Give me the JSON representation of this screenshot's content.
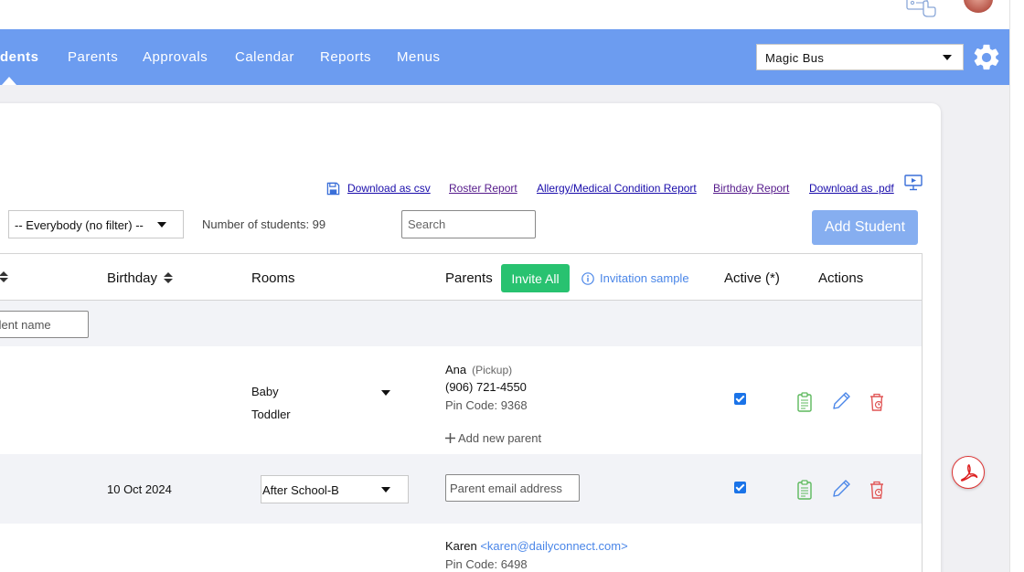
{
  "nav": {
    "items": [
      "dents",
      "Parents",
      "Approvals",
      "Calendar",
      "Reports",
      "Menus"
    ],
    "active_index": 0,
    "org_select": "Magic Bus"
  },
  "toolbar": {
    "download_csv": "Download as csv",
    "roster_report": "Roster Report",
    "allergy_report": "Allergy/Medical Condition Report",
    "birthday_report": "Birthday Report",
    "download_pdf": "Download as .pdf"
  },
  "controls": {
    "filter_value": "-- Everybody (no filter) --",
    "student_count": "Number of students: 99",
    "search_placeholder": "Search",
    "add_student": "Add Student"
  },
  "table": {
    "headers": {
      "birthday": "Birthday",
      "rooms": "Rooms",
      "parents": "Parents",
      "invite_all": "Invite All",
      "invitation_sample": "Invitation sample",
      "active": "Active (*)",
      "actions": "Actions"
    },
    "name_filter_placeholder": "udent name",
    "rows": [
      {
        "birthday": "",
        "rooms": [
          "Baby",
          "Toddler"
        ],
        "parent_name": "Ana",
        "parent_role": "(Pickup)",
        "parent_phone": "(906) 721-4550",
        "pin_code": "Pin Code: 9368",
        "add_parent": "Add new parent",
        "active": true
      },
      {
        "birthday": "10 Oct 2024",
        "room_select": "After School-B",
        "email_placeholder": "Parent email address",
        "active": true
      },
      {
        "parent_name": "Karen",
        "parent_email": "<karen@dailyconnect.com>",
        "pin_code": "Pin Code: 6498"
      }
    ]
  },
  "colors": {
    "nav_bg": "#6c9cf0",
    "invite_green": "#28c270",
    "add_student_bg": "#86aef0",
    "clipboard_green": "#5cb85c",
    "pencil_blue": "#4a86e8",
    "trash_red": "#e05555"
  },
  "icons": [
    "help-hand-icon",
    "gear-icon",
    "save-icon",
    "monitor-play-icon",
    "sort-icon",
    "info-icon",
    "plus-icon",
    "clipboard-icon",
    "pencil-icon",
    "trash-icon",
    "pdf-icon"
  ]
}
